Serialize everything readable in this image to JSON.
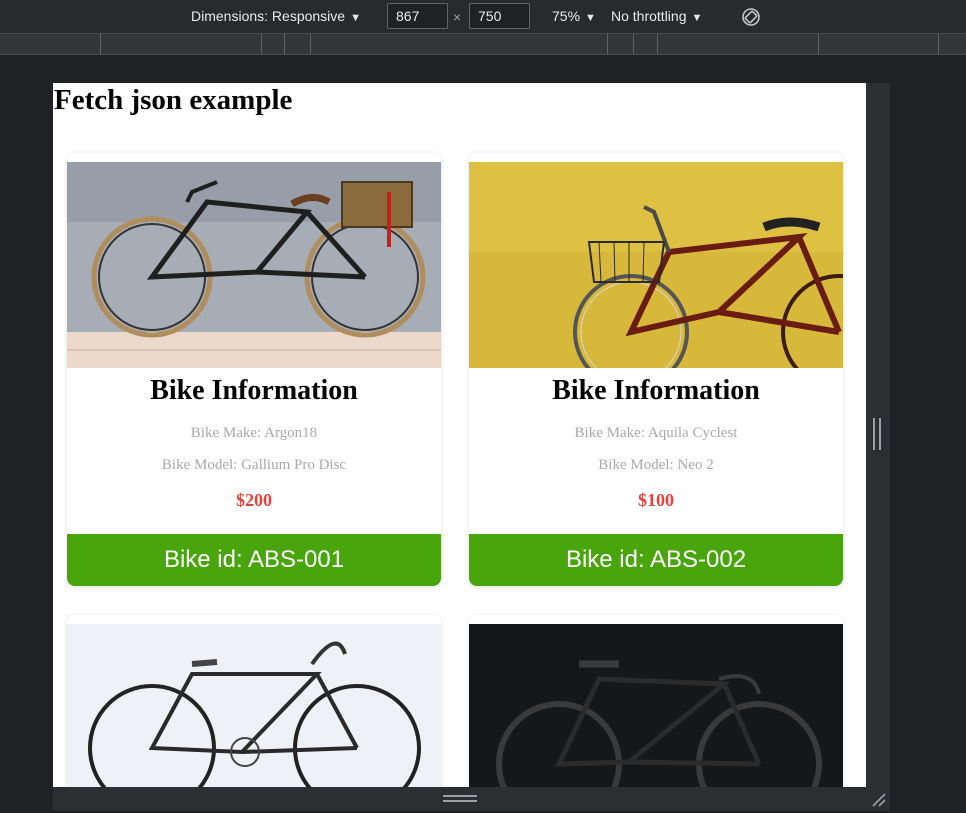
{
  "devtools": {
    "dimensions_label": "Dimensions: Responsive",
    "width_value": "867",
    "height_value": "750",
    "zoom": "75%",
    "throttling": "No throttling"
  },
  "page": {
    "title": "Fetch json example"
  },
  "cards": [
    {
      "title": "Bike Information",
      "make": "Bike Make: Argon18",
      "model": "Bike Model: Gallium Pro Disc",
      "price": "$200",
      "id_label": "Bike id: ABS-001"
    },
    {
      "title": "Bike Information",
      "make": "Bike Make: Aquila Cyclest",
      "model": "Bike Model: Neo 2",
      "price": "$100",
      "id_label": "Bike id: ABS-002"
    }
  ],
  "colors": {
    "footer_green": "#48a50b",
    "price_red": "#e8413a",
    "muted_text": "#a9a9a9"
  }
}
